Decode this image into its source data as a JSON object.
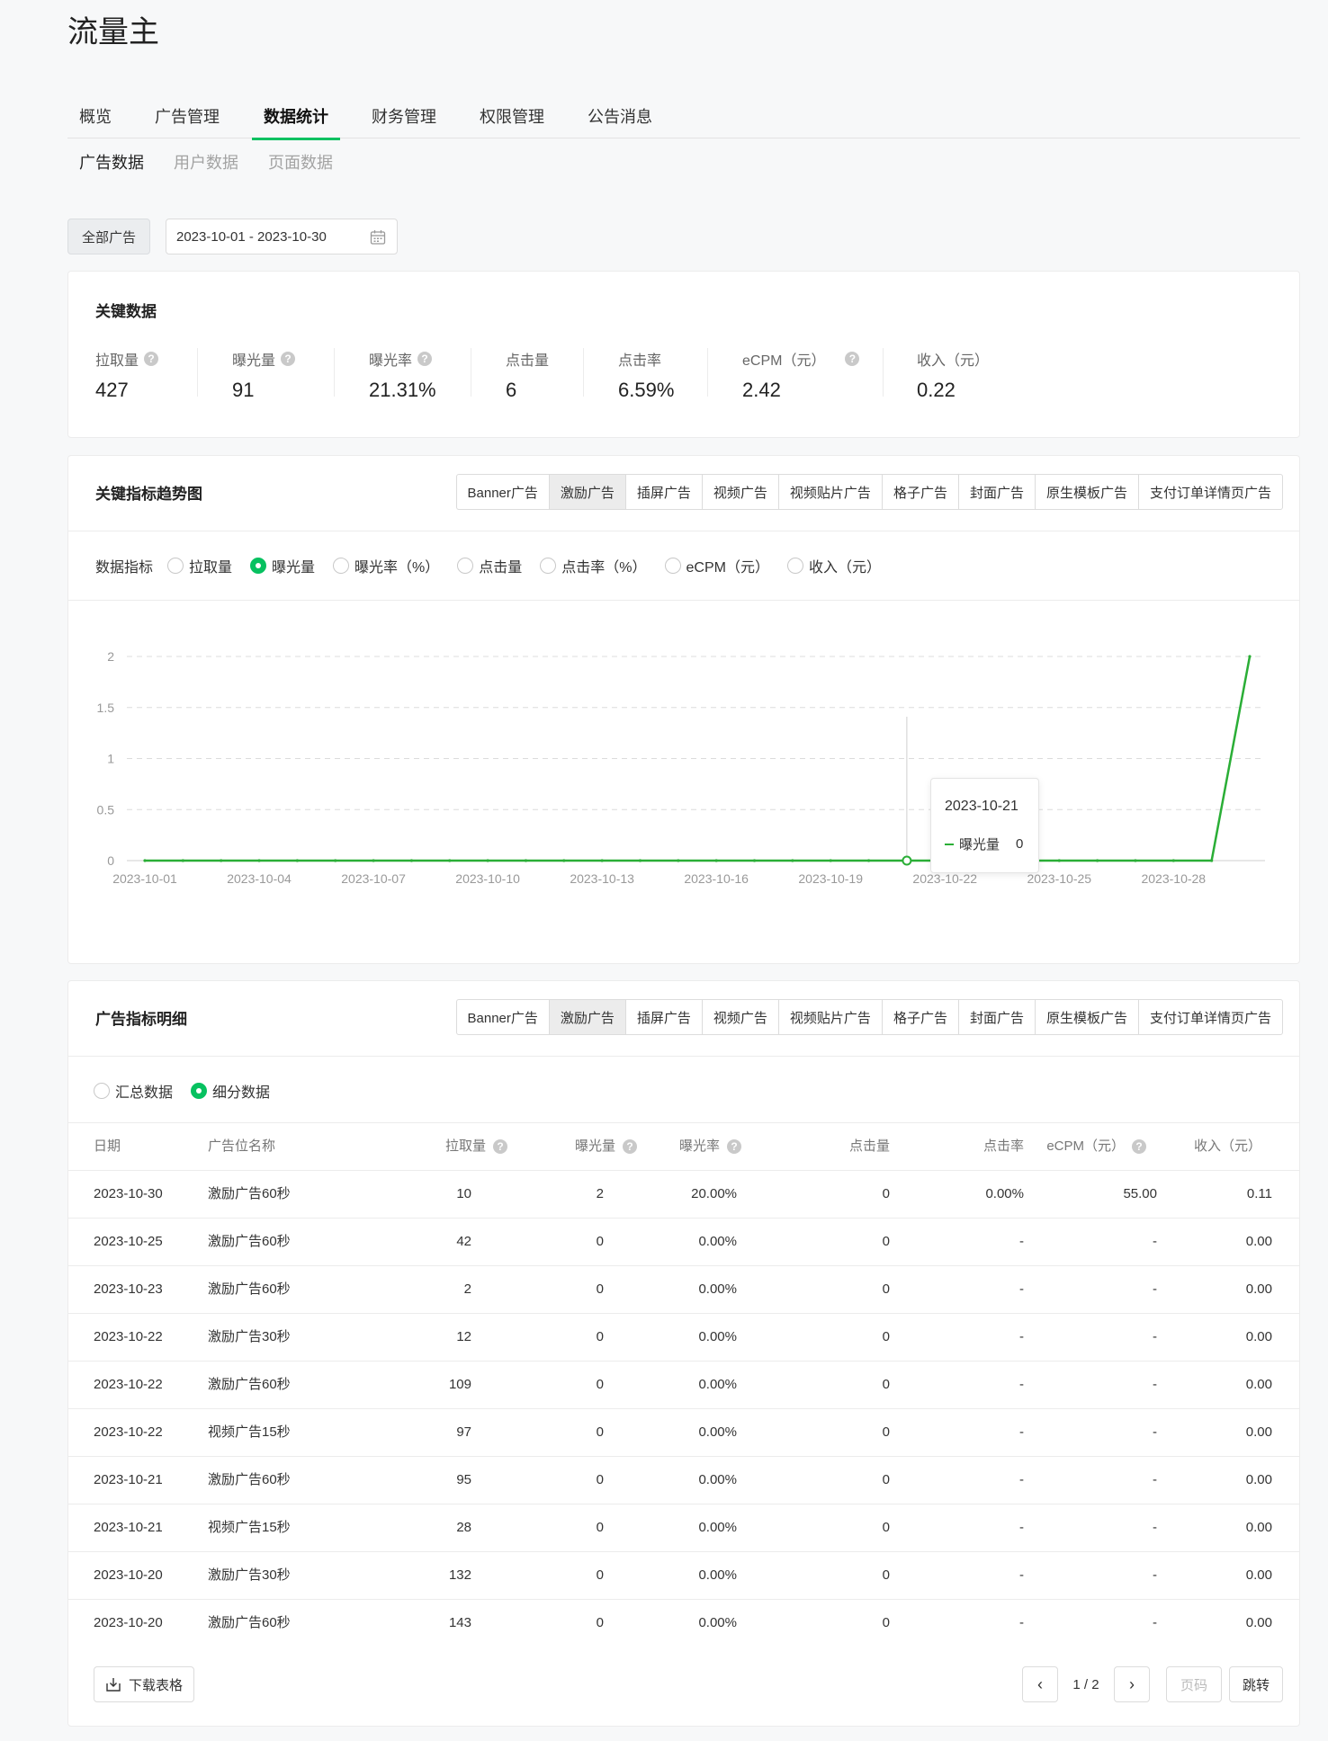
{
  "app": {
    "title": "流量主"
  },
  "main_nav": [
    {
      "label": "概览",
      "active": false
    },
    {
      "label": "广告管理",
      "active": false
    },
    {
      "label": "数据统计",
      "active": true
    },
    {
      "label": "财务管理",
      "active": false
    },
    {
      "label": "权限管理",
      "active": false
    },
    {
      "label": "公告消息",
      "active": false
    }
  ],
  "sub_nav": [
    {
      "label": "广告数据",
      "active": true
    },
    {
      "label": "用户数据",
      "active": false
    },
    {
      "label": "页面数据",
      "active": false
    }
  ],
  "filters": {
    "ad_scope": "全部广告",
    "date_range": "2023-10-01 - 2023-10-30"
  },
  "key_data": {
    "title": "关键数据",
    "metrics": [
      {
        "label": "拉取量",
        "value": "427",
        "help": true
      },
      {
        "label": "曝光量",
        "value": "91",
        "help": true
      },
      {
        "label": "曝光率",
        "value": "21.31%",
        "help": true
      },
      {
        "label": "点击量",
        "value": "6",
        "help": false
      },
      {
        "label": "点击率",
        "value": "6.59%",
        "help": false
      },
      {
        "label": "eCPM（元）",
        "value": "2.42",
        "help": true
      },
      {
        "label": "收入（元）",
        "value": "0.22",
        "help": false
      }
    ]
  },
  "ad_types": [
    "Banner广告",
    "激励广告",
    "插屏广告",
    "视频广告",
    "视频贴片广告",
    "格子广告",
    "封面广告",
    "原生模板广告",
    "支付订单详情页广告"
  ],
  "ad_types_active": 1,
  "trend": {
    "title": "关键指标趋势图",
    "metric_label": "数据指标",
    "metrics": [
      {
        "label": "拉取量",
        "selected": false
      },
      {
        "label": "曝光量",
        "selected": true
      },
      {
        "label": "曝光率（%）",
        "selected": false
      },
      {
        "label": "点击量",
        "selected": false
      },
      {
        "label": "点击率（%）",
        "selected": false
      },
      {
        "label": "eCPM（元）",
        "selected": false
      },
      {
        "label": "收入（元）",
        "selected": false
      }
    ],
    "tooltip": {
      "date": "2023-10-21",
      "series": "曝光量",
      "value": "0"
    }
  },
  "chart_data": {
    "type": "line",
    "title": "",
    "xlabel": "",
    "ylabel": "",
    "x": [
      "2023-10-01",
      "2023-10-02",
      "2023-10-03",
      "2023-10-04",
      "2023-10-05",
      "2023-10-06",
      "2023-10-07",
      "2023-10-08",
      "2023-10-09",
      "2023-10-10",
      "2023-10-11",
      "2023-10-12",
      "2023-10-13",
      "2023-10-14",
      "2023-10-15",
      "2023-10-16",
      "2023-10-17",
      "2023-10-18",
      "2023-10-19",
      "2023-10-20",
      "2023-10-21",
      "2023-10-22",
      "2023-10-23",
      "2023-10-24",
      "2023-10-25",
      "2023-10-26",
      "2023-10-27",
      "2023-10-28",
      "2023-10-29",
      "2023-10-30"
    ],
    "x_tick_labels": [
      "2023-10-01",
      "2023-10-04",
      "2023-10-07",
      "2023-10-10",
      "2023-10-13",
      "2023-10-16",
      "2023-10-19",
      "2023-10-22",
      "2023-10-25",
      "2023-10-28"
    ],
    "series": [
      {
        "name": "曝光量",
        "values": [
          0,
          0,
          0,
          0,
          0,
          0,
          0,
          0,
          0,
          0,
          0,
          0,
          0,
          0,
          0,
          0,
          0,
          0,
          0,
          0,
          0,
          0,
          0,
          0,
          0,
          0,
          0,
          0,
          0,
          2
        ]
      }
    ],
    "ylim": [
      0,
      2
    ],
    "y_ticks": [
      "0",
      "0.5",
      "1",
      "1.5",
      "2"
    ],
    "grid": true,
    "color": "#2aae36",
    "highlight_x": "2023-10-21"
  },
  "detail": {
    "title": "广告指标明细",
    "view_modes": [
      {
        "label": "汇总数据",
        "selected": false
      },
      {
        "label": "细分数据",
        "selected": true
      }
    ],
    "columns": [
      {
        "label": "日期",
        "help": false
      },
      {
        "label": "广告位名称",
        "help": false
      },
      {
        "label": "拉取量",
        "help": true
      },
      {
        "label": "曝光量",
        "help": true
      },
      {
        "label": "曝光率",
        "help": true
      },
      {
        "label": "点击量",
        "help": false
      },
      {
        "label": "点击率",
        "help": false
      },
      {
        "label": "eCPM（元）",
        "help": true
      },
      {
        "label": "收入（元）",
        "help": false
      }
    ],
    "rows": [
      [
        "2023-10-30",
        "激励广告60秒",
        "10",
        "2",
        "20.00%",
        "0",
        "0.00%",
        "55.00",
        "0.11"
      ],
      [
        "2023-10-25",
        "激励广告60秒",
        "42",
        "0",
        "0.00%",
        "0",
        "-",
        "-",
        "0.00"
      ],
      [
        "2023-10-23",
        "激励广告60秒",
        "2",
        "0",
        "0.00%",
        "0",
        "-",
        "-",
        "0.00"
      ],
      [
        "2023-10-22",
        "激励广告30秒",
        "12",
        "0",
        "0.00%",
        "0",
        "-",
        "-",
        "0.00"
      ],
      [
        "2023-10-22",
        "激励广告60秒",
        "109",
        "0",
        "0.00%",
        "0",
        "-",
        "-",
        "0.00"
      ],
      [
        "2023-10-22",
        "视频广告15秒",
        "97",
        "0",
        "0.00%",
        "0",
        "-",
        "-",
        "0.00"
      ],
      [
        "2023-10-21",
        "激励广告60秒",
        "95",
        "0",
        "0.00%",
        "0",
        "-",
        "-",
        "0.00"
      ],
      [
        "2023-10-21",
        "视频广告15秒",
        "28",
        "0",
        "0.00%",
        "0",
        "-",
        "-",
        "0.00"
      ],
      [
        "2023-10-20",
        "激励广告30秒",
        "132",
        "0",
        "0.00%",
        "0",
        "-",
        "-",
        "0.00"
      ],
      [
        "2023-10-20",
        "激励广告60秒",
        "143",
        "0",
        "0.00%",
        "0",
        "-",
        "-",
        "0.00"
      ]
    ],
    "download_label": "下载表格",
    "pagination": {
      "current": "1 / 2",
      "page_placeholder": "页码",
      "jump_label": "跳转"
    }
  }
}
